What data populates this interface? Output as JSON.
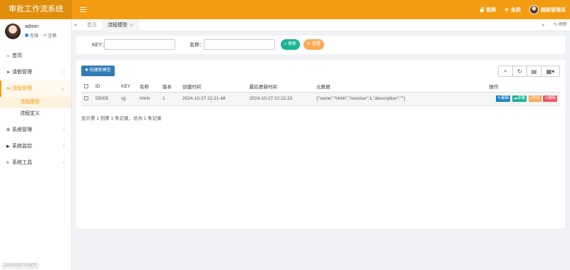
{
  "app": {
    "title": "审批工作流系统",
    "top_actions": [
      {
        "icon": "lock-icon",
        "label": "锁屏"
      },
      {
        "icon": "fullscreen-icon",
        "label": "全屏"
      },
      {
        "icon": "avatar",
        "label": "超级管理员"
      }
    ]
  },
  "user": {
    "name": "admin",
    "status": "在线",
    "logout": "注销"
  },
  "sidebar": {
    "items": [
      {
        "icon": "home-icon",
        "label": "首页",
        "has_children": false
      },
      {
        "icon": "send-icon",
        "label": "请假管理",
        "has_children": true
      },
      {
        "icon": "share-icon",
        "label": "流程管理",
        "has_children": true,
        "active": true,
        "children": [
          {
            "label": "流程模型",
            "active": true
          },
          {
            "label": "流程定义",
            "active": false
          }
        ]
      },
      {
        "icon": "gear-icon",
        "label": "系统管理",
        "has_children": true
      },
      {
        "icon": "video-icon",
        "label": "系统监控",
        "has_children": true
      },
      {
        "icon": "bars-icon",
        "label": "系统工具",
        "has_children": true
      }
    ],
    "footer_hint": "javascript:void(0)"
  },
  "tabbar": {
    "tabs": [
      {
        "label": "首页",
        "active": false
      },
      {
        "label": "流程模型",
        "active": true
      }
    ],
    "refresh_label": "刷新"
  },
  "search": {
    "key_label": "KEY：",
    "key_value": "",
    "name_label": "名称：",
    "name_value": "",
    "search_button": "搜索",
    "reset_button": "重置"
  },
  "toolbar": {
    "create_button": "创建新模型",
    "tools": [
      "search-icon",
      "refresh-icon",
      "columns-icon",
      "grid-icon"
    ]
  },
  "table": {
    "headers": [
      "ID",
      "KEY",
      "名称",
      "版本",
      "创建时间",
      "最后更新时间",
      "元数据",
      "操作"
    ],
    "rows": [
      {
        "id": "55005",
        "key": "vjj",
        "name": "hhhh",
        "version": "1",
        "created": "2024-10-27 22:21:48",
        "updated": "2024-10-27 22:22:23",
        "meta": "{\"name\":\"hhhh\",\"revision\":1,\"description\":\"\"}",
        "ops": [
          "编辑",
          "部署",
          "导出",
          "删除"
        ]
      }
    ],
    "pagination_info": "显示第 1 到第 1 条记录，总共 1 条记录"
  },
  "colors": {
    "brand": "#f39c12",
    "brand_dark": "#e08e0b",
    "primary": "#337ab7",
    "success": "#1ab394",
    "warning": "#f8ac59",
    "danger": "#ed5565"
  }
}
